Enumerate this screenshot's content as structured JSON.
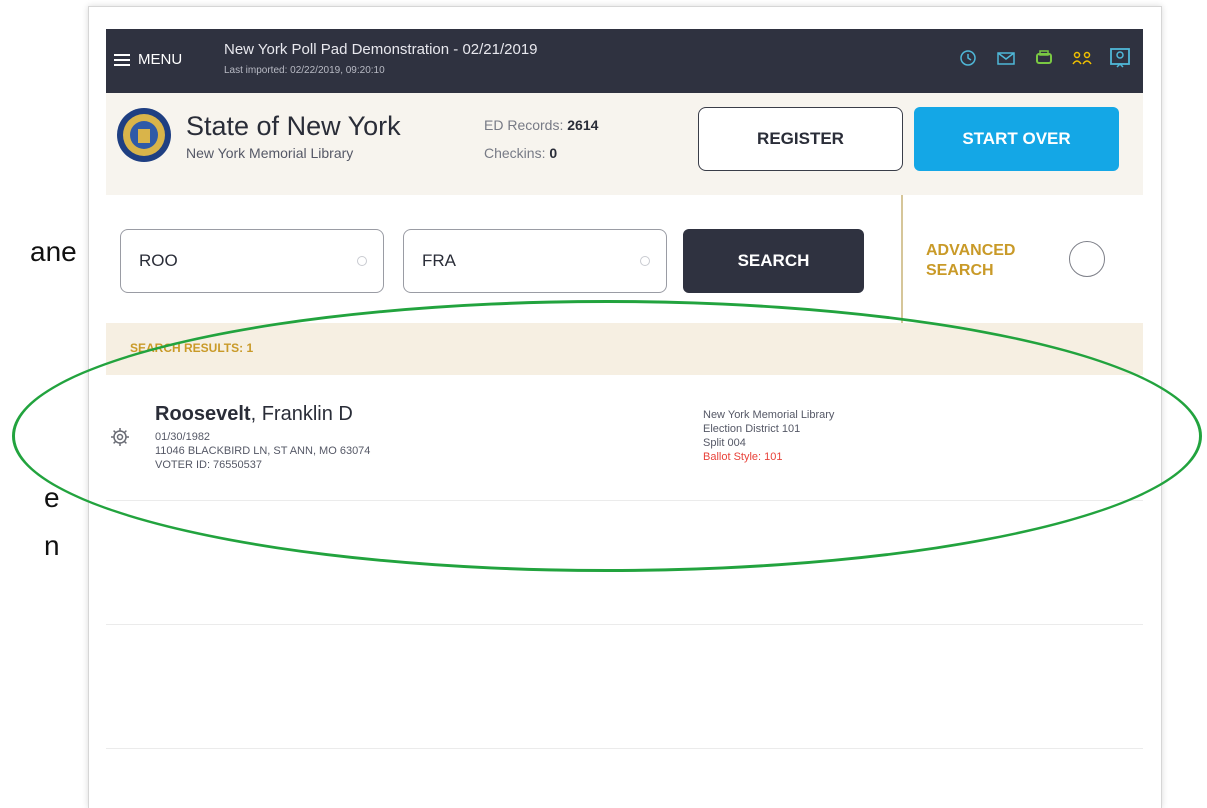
{
  "cut_off_text": [
    "ane",
    "e",
    "n"
  ],
  "topbar": {
    "menu_label": "MENU",
    "app_title": "New York Poll Pad Demonstration - 02/21/2019",
    "last_imported": "Last imported: 02/22/2019, 09:20:10",
    "icons": [
      "history-icon",
      "mail-icon",
      "printer-icon",
      "users-icon",
      "chat-icon"
    ],
    "icon_colors": {
      "default": "#4fb8d8",
      "printer": "#7ac943",
      "users": "#f2c200"
    }
  },
  "header": {
    "org_name": "State of New York",
    "org_sub": "New York Memorial Library",
    "ed_records_label": "ED Records:",
    "ed_records_value": "2614",
    "checkins_label": "Checkins:",
    "checkins_value": "0",
    "register_label": "REGISTER",
    "start_over_label": "START OVER"
  },
  "search": {
    "last_name_value": "ROO",
    "first_name_value": "FRA",
    "search_label": "SEARCH",
    "advanced_line1": "ADVANCED",
    "advanced_line2": "SEARCH"
  },
  "results": {
    "label": "SEARCH RESULTS: 1",
    "items": [
      {
        "last_name": "Roosevelt",
        "first_name": ", Franklin D",
        "dob": "01/30/1982",
        "address": "11046 BLACKBIRD LN, ST ANN, MO 63074",
        "voter_id": "VOTER ID: 76550537",
        "location": "New York Memorial Library",
        "district": "Election District 101",
        "split": "Split 004",
        "ballot_style": "Ballot Style: 101"
      }
    ]
  },
  "colors": {
    "topbar_bg": "#2f3240",
    "accent_blue": "#14a7e6",
    "accent_gold": "#c99a28",
    "highlight_green": "#22a33e",
    "ballot_red": "#e8423a"
  }
}
